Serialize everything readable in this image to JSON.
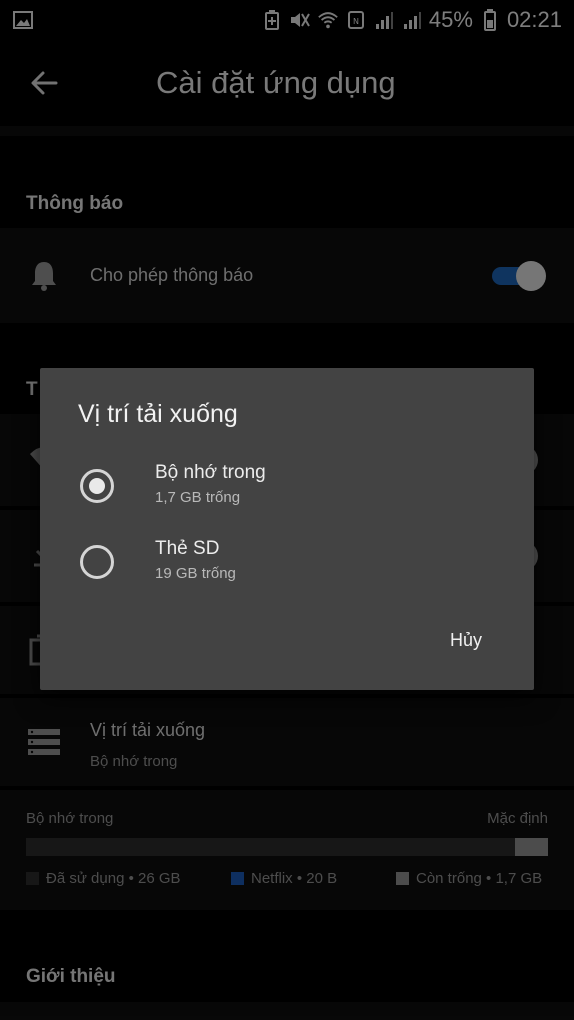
{
  "status_bar": {
    "battery_percent": "45%",
    "time": "02:21",
    "icons": [
      "image-notification-icon",
      "battery-saver-icon",
      "mute-icon",
      "wifi-icon",
      "nfc-icon",
      "signal-icon-1",
      "signal-icon-2",
      "battery-icon"
    ]
  },
  "app_bar": {
    "title": "Cài đặt ứng dụng",
    "back_icon": "arrow-left-icon"
  },
  "notifications_section": {
    "header": "Thông báo",
    "allow_label": "Cho phép thông báo",
    "allow_enabled": true
  },
  "download_section": {
    "header_partial": "T",
    "location_label": "Vị trí tải xuống",
    "location_value": "Bộ nhớ trong"
  },
  "storage": {
    "left_label": "Bộ nhớ trong",
    "right_label": "Mặc định",
    "free_fraction": 0.063,
    "legend": [
      {
        "label": "Đã sử dụng • 26 GB",
        "color": "#2b2b2b"
      },
      {
        "label": "Netflix • 20 B",
        "color": "#1a56b0"
      },
      {
        "label": "Còn trống • 1,7 GB",
        "color": "#8a8a8a"
      }
    ]
  },
  "about_section": {
    "header": "Giới thiệu"
  },
  "dialog": {
    "title": "Vị trí tải xuống",
    "options": [
      {
        "label": "Bộ nhớ trong",
        "sub": "1,7 GB trống",
        "selected": true
      },
      {
        "label": "Thẻ SD",
        "sub": "19 GB trống",
        "selected": false
      }
    ],
    "cancel_label": "Hủy"
  },
  "colors": {
    "accent": "#1c5fad",
    "dialog_bg": "#434343",
    "background": "#000000"
  }
}
